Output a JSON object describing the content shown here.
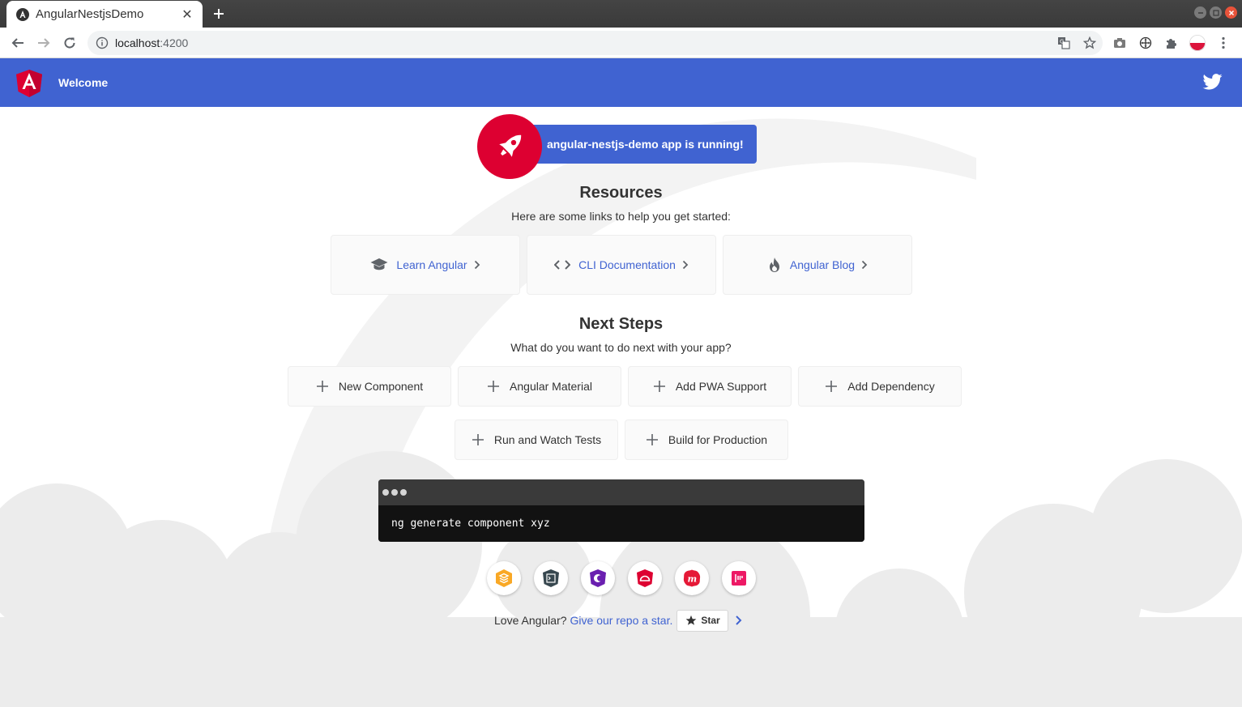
{
  "browser": {
    "tab_title": "AngularNestjsDemo",
    "tab_favicon": "angular-icon",
    "url_host": "localhost",
    "url_port": ":4200"
  },
  "app": {
    "header_title": "Welcome",
    "running_text": "angular-nestjs-demo app is running!",
    "resources_title": "Resources",
    "resources_subtitle": "Here are some links to help you get started:",
    "resources": [
      {
        "label": "Learn Angular",
        "icon": "graduation-cap-icon"
      },
      {
        "label": "CLI Documentation",
        "icon": "code-icon"
      },
      {
        "label": "Angular Blog",
        "icon": "fire-icon"
      }
    ],
    "next_steps_title": "Next Steps",
    "next_steps_subtitle": "What do you want to do next with your app?",
    "steps": [
      {
        "label": "New Component"
      },
      {
        "label": "Angular Material"
      },
      {
        "label": "Add PWA Support"
      },
      {
        "label": "Add Dependency"
      },
      {
        "label": "Run and Watch Tests"
      },
      {
        "label": "Build for Production"
      }
    ],
    "terminal_command": "ng generate component xyz",
    "footer_love": "Love Angular?",
    "footer_link": "Give our repo a star.",
    "star_label": "Star"
  },
  "colors": {
    "brand_blue": "#4063d1",
    "angular_red": "#dd0031"
  }
}
